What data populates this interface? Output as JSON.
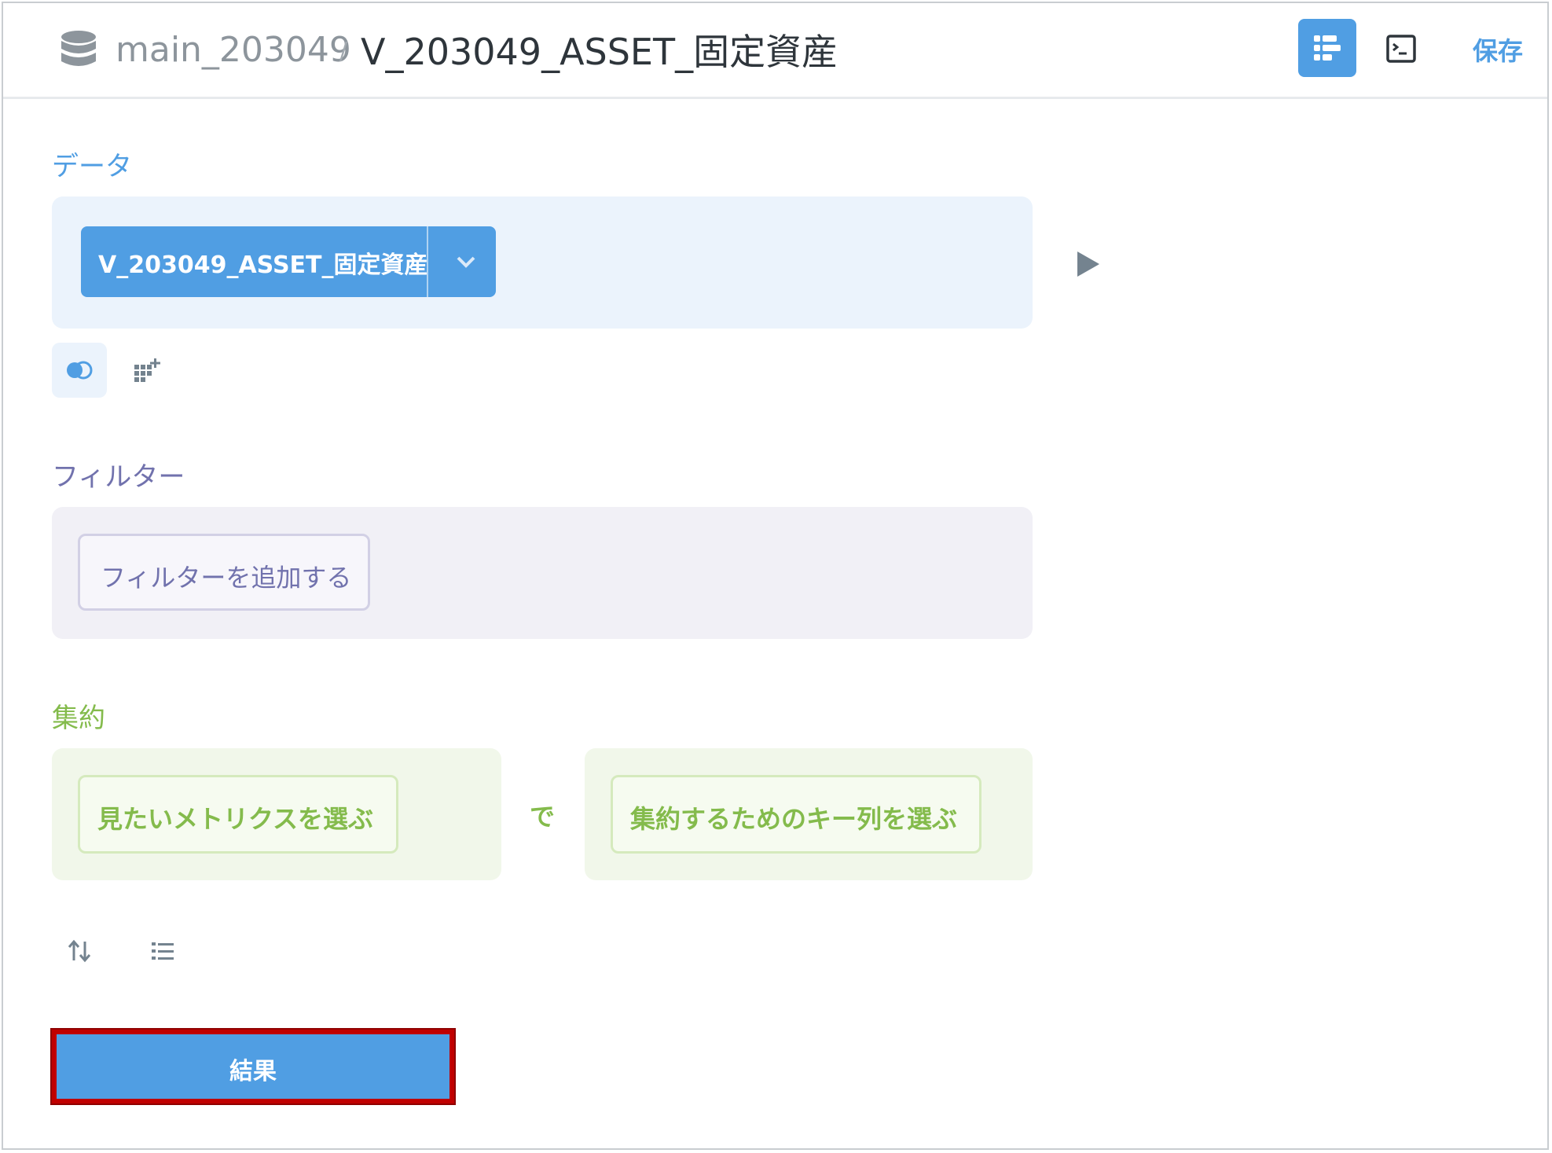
{
  "header": {
    "database_icon": "database-icon",
    "database_name": "main_203049",
    "separator": "/",
    "title": "V_203049_ASSET_固定資産",
    "notebook_icon": "notebook-icon",
    "sql_icon": "terminal-icon",
    "save_label": "保存"
  },
  "data_step": {
    "label": "データ",
    "table_name": "V_203049_ASSET_固定資産",
    "dropdown_icon": "chevron-down-icon",
    "preview_icon": "play-icon",
    "join_icon": "join-icon",
    "custom_column_icon": "custom-column-icon"
  },
  "filter_step": {
    "label": "フィルター",
    "add_filter": "フィルターを追加する"
  },
  "summarize_step": {
    "label": "集約",
    "metric_placeholder": "見たいメトリクスを選ぶ",
    "by": "で",
    "breakout_placeholder": "集約するためのキー列を選ぶ"
  },
  "actions": {
    "sort_icon": "sort-icon",
    "limit_icon": "list-icon",
    "visualize_label": "結果"
  },
  "colors": {
    "brand": "#509ee3",
    "filter": "#7172ad",
    "summarize": "#84bb4c",
    "highlight_border": "#c00000"
  }
}
